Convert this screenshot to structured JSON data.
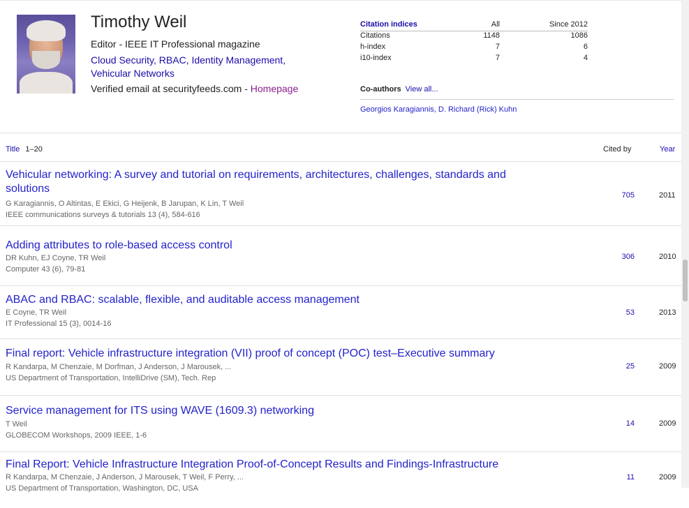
{
  "profile": {
    "name": "Timothy Weil",
    "affiliation": "Editor - IEEE IT Professional magazine",
    "interests_line1": "Cloud Security, RBAC, Identity Management,",
    "interests_line2": "Vehicular Networks",
    "verified": "Verified email at securityfeeds.com - ",
    "homepage": "Homepage"
  },
  "citations": {
    "title": "Citation indices",
    "col_all": "All",
    "col_since": "Since 2012",
    "rows": [
      {
        "label": "Citations",
        "all": "1148",
        "since": "1086"
      },
      {
        "label": "h-index",
        "all": "7",
        "since": "6"
      },
      {
        "label": "i10-index",
        "all": "7",
        "since": "4"
      }
    ]
  },
  "coauthors": {
    "label": "Co-authors",
    "view_all": "View all...",
    "names": "Georgios Karagiannis,  D. Richard (Rick) Kuhn"
  },
  "table": {
    "title_label": "Title",
    "range": "1–20",
    "cited_by_label": "Cited by",
    "year_label": "Year"
  },
  "articles": [
    {
      "title_line1": "Vehicular networking: A survey and tutorial on requirements, architectures, challenges, standards and",
      "title_line2": "solutions",
      "authors": "G Karagiannis, O Altintas, E Ekici, G Heijenk, B Jarupan, K Lin, T Weil",
      "venue": "IEEE communications surveys & tutorials 13 (4), 584-616",
      "cited_by": "705",
      "year": "2011"
    },
    {
      "title_line1": "Adding attributes to role-based access control",
      "authors": "DR Kuhn, EJ Coyne, TR Weil",
      "venue": "Computer 43 (6), 79-81",
      "cited_by": "306",
      "year": "2010"
    },
    {
      "title_line1": "ABAC and RBAC: scalable, flexible, and auditable access management",
      "authors": "E Coyne, TR Weil",
      "venue": "IT Professional 15 (3), 0014-16",
      "cited_by": "53",
      "year": "2013"
    },
    {
      "title_line1": "Final report: Vehicle infrastructure integration (VII) proof of concept (POC) test–Executive summary",
      "authors": "R Kandarpa, M Chenzaie, M Dorfman, J Anderson, J Marousek, ...",
      "venue": "US Department of Transportation, IntelliDrive (SM), Tech. Rep",
      "cited_by": "25",
      "year": "2009"
    },
    {
      "title_line1": "Service management for ITS using WAVE (1609.3) networking",
      "authors": "T Weil",
      "venue": "GLOBECOM Workshops, 2009 IEEE, 1-6",
      "cited_by": "14",
      "year": "2009"
    },
    {
      "title_line1": "Final Report: Vehicle Infrastructure Integration Proof-of-Concept Results and Findings-Infrastructure",
      "authors": "R Kandarpa, M Chenzaie, J Anderson, J Marousek, T Weil, F Perry, ...",
      "venue": "US Department of Transportation, Washington, DC, USA",
      "cited_by": "11",
      "year": "2009"
    }
  ]
}
